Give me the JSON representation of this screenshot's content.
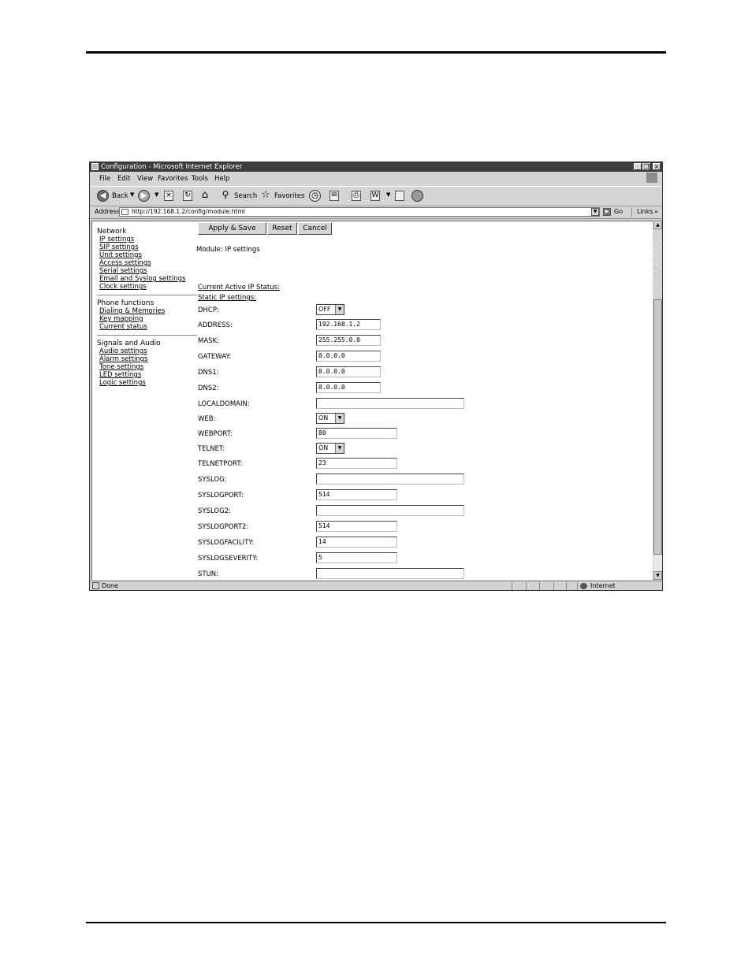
{
  "window": {
    "title": "Configuration - Microsoft Internet Explorer",
    "controls": {
      "minimize": "_",
      "restore": "❐",
      "close": "×"
    }
  },
  "menu": [
    "File",
    "Edit",
    "View",
    "Favorites",
    "Tools",
    "Help"
  ],
  "toolbar": {
    "back_label": "Back",
    "search_label": "Search",
    "favorites_label": "Favorites",
    "icons": [
      "back-icon",
      "forward-icon",
      "stop-icon",
      "refresh-icon",
      "home-icon",
      "search-icon",
      "favorites-star-icon",
      "history-icon",
      "mail-icon",
      "print-icon",
      "edit-icon",
      "discuss-icon",
      "messenger-icon"
    ]
  },
  "address": {
    "label": "Address",
    "url": "http://192.168.1.2/config/module.html",
    "go_label": "Go",
    "links_label": "Links"
  },
  "nav": {
    "sections": [
      {
        "heading": "Network",
        "links": [
          "IP settings",
          "SIP settings",
          "Unit settings",
          "Access settings",
          "Serial settings",
          "Email and Syslog settings",
          "Clock settings"
        ]
      },
      {
        "heading": "Phone functions",
        "links": [
          "Dialing & Memories",
          "Key mapping",
          "Current status"
        ]
      },
      {
        "heading": "Signals and Audio",
        "links": [
          "Audio settings",
          "Alarm settings",
          "Tone settings",
          "LED settings",
          "Logic settings"
        ]
      }
    ]
  },
  "content": {
    "buttons": {
      "apply": "Apply & Save",
      "reset": "Reset",
      "cancel": "Cancel"
    },
    "module_title": "Module: IP settings",
    "current_status_link": "Current Active IP Status:",
    "static_header": "Static IP settings:",
    "fields": [
      {
        "label": "DHCP:",
        "type": "select",
        "value": "OFF"
      },
      {
        "label": "ADDRESS:",
        "type": "text",
        "value": "192.168.1.2"
      },
      {
        "label": "MASK:",
        "type": "text",
        "value": "255.255.0.0"
      },
      {
        "label": "GATEWAY:",
        "type": "text",
        "value": "0.0.0.0"
      },
      {
        "label": "DNS1:",
        "type": "text",
        "value": "0.0.0.0"
      },
      {
        "label": "DNS2:",
        "type": "text",
        "value": "0.0.0.0"
      },
      {
        "label": "LOCALDOMAIN:",
        "type": "text",
        "value": ""
      },
      {
        "label": "WEB:",
        "type": "select",
        "value": "ON"
      },
      {
        "label": "WEBPORT:",
        "type": "text",
        "value": "80"
      },
      {
        "label": "TELNET:",
        "type": "select",
        "value": "ON"
      },
      {
        "label": "TELNETPORT:",
        "type": "text",
        "value": "23"
      },
      {
        "label": "SYSLOG:",
        "type": "text",
        "value": ""
      },
      {
        "label": "SYSLOGPORT:",
        "type": "text",
        "value": "514"
      },
      {
        "label": "SYSLOG2:",
        "type": "text",
        "value": ""
      },
      {
        "label": "SYSLOGPORT2:",
        "type": "text",
        "value": "514"
      },
      {
        "label": "SYSLOGFACILITY:",
        "type": "text",
        "value": "14"
      },
      {
        "label": "SYSLOGSEVERITY:",
        "type": "text",
        "value": "5"
      },
      {
        "label": "STUN:",
        "type": "text",
        "value": ""
      }
    ]
  },
  "status": {
    "text": "Done",
    "zone": "Internet"
  }
}
